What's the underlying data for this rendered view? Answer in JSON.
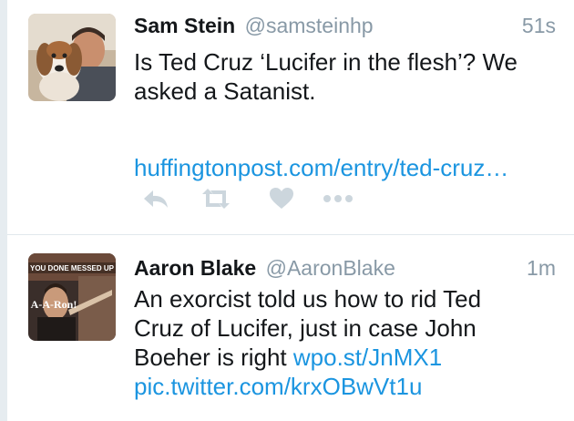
{
  "tweets": [
    {
      "name": "Sam Stein",
      "handle": "@samsteinhp",
      "time": "51s",
      "text_lines": [
        "Is Ted Cruz ‘Lucifer in the flesh’? We",
        "asked a Satanist."
      ],
      "link": "huffingtonpost.com/entry/ted-cruz…",
      "actions": [
        "reply-icon",
        "retweet-icon",
        "like-icon",
        "more-icon"
      ]
    },
    {
      "name": "Aaron Blake",
      "handle": "@AaronBlake",
      "time": "1m",
      "avatar_text_top": "YOU DONE MESSED UP",
      "avatar_text_bottom": "A-A-Ron!",
      "text_lines": [
        "An exorcist told us how to rid Ted",
        "Cruz of Lucifer, just in case John",
        "Boeher is right"
      ],
      "inline_link": "wpo.st/JnMX1",
      "pic_link": "pic.twitter.com/krxOBwVt1u"
    }
  ],
  "colors": {
    "link": "#1b95e0",
    "secondary_text": "#8899a6",
    "action_icon": "#ccd6dd",
    "divider": "#e1e8ed"
  }
}
